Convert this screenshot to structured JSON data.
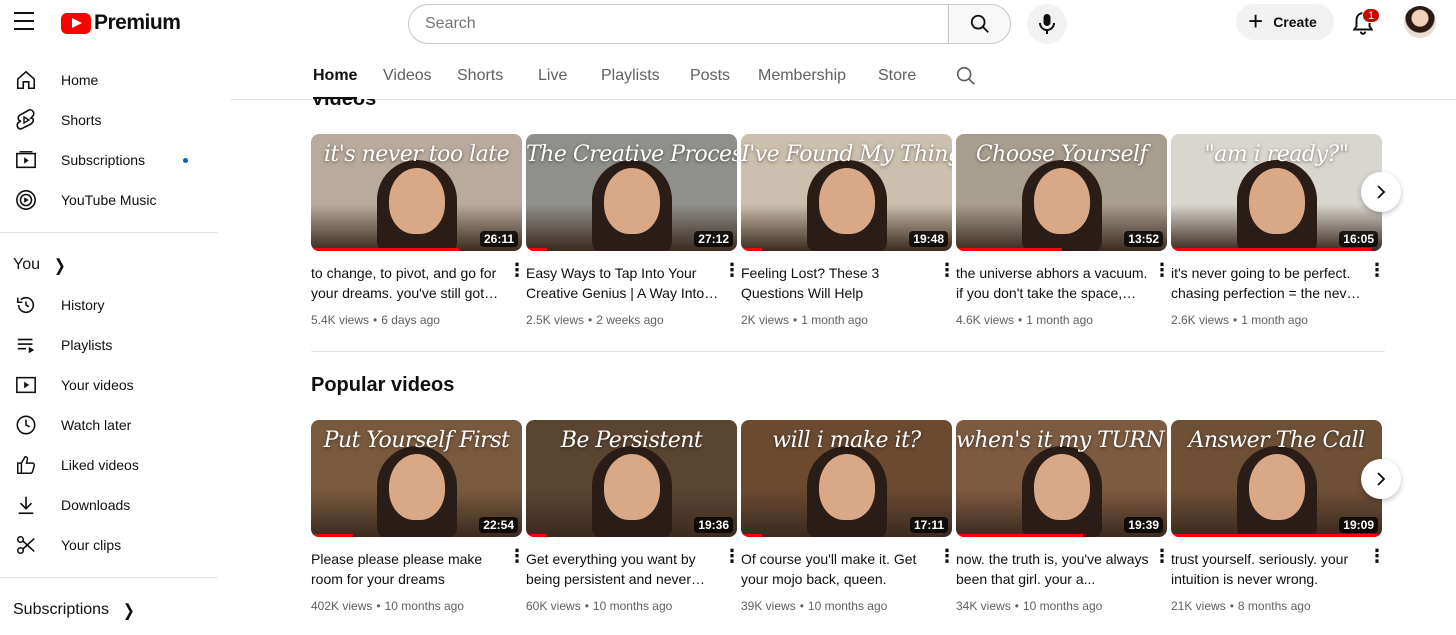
{
  "header": {
    "logo_text": "Premium",
    "search_placeholder": "Search",
    "create_label": "Create",
    "notification_count": "1"
  },
  "sidebar": {
    "main": [
      {
        "label": "Home",
        "icon": "home-icon"
      },
      {
        "label": "Shorts",
        "icon": "shorts-icon"
      },
      {
        "label": "Subscriptions",
        "icon": "subscriptions-icon"
      },
      {
        "label": "YouTube Music",
        "icon": "youtube-music-icon"
      }
    ],
    "you_heading": "You",
    "you": [
      {
        "label": "History",
        "icon": "history-icon"
      },
      {
        "label": "Playlists",
        "icon": "playlists-icon"
      },
      {
        "label": "Your videos",
        "icon": "your-videos-icon"
      },
      {
        "label": "Watch later",
        "icon": "watch-later-icon"
      },
      {
        "label": "Liked videos",
        "icon": "liked-videos-icon"
      },
      {
        "label": "Downloads",
        "icon": "downloads-icon"
      },
      {
        "label": "Your clips",
        "icon": "clips-icon"
      }
    ],
    "subscriptions_heading": "Subscriptions"
  },
  "tabs": [
    "Home",
    "Videos",
    "Shorts",
    "Live",
    "Playlists",
    "Posts",
    "Membership",
    "Store"
  ],
  "sections": [
    {
      "title": "Videos",
      "videos": [
        {
          "thumb_text": "it's never too late",
          "duration": "26:11",
          "title": "to change, to pivot, and go for your dreams. you've still got time.",
          "views": "5.4K views",
          "age": "6 days ago",
          "bg": "#b8aa9c",
          "progress": 0.7
        },
        {
          "thumb_text": "The Creative Process",
          "duration": "27:12",
          "title": "Easy Ways to Tap Into Your Creative Genius | A Way Into the Creative Process",
          "views": "2.5K views",
          "age": "2 weeks ago",
          "bg": "#8f8f8c",
          "progress": 0.1
        },
        {
          "thumb_text": "I've Found My Thing",
          "duration": "19:48",
          "title": "Feeling Lost? These 3 Questions Will Help",
          "views": "2K views",
          "age": "1 month ago",
          "bg": "#cbbfae",
          "progress": 0.1
        },
        {
          "thumb_text": "Choose Yourself",
          "duration": "13:52",
          "title": "the universe abhors a vacuum. if you don't take the space, someone else will.",
          "views": "4.6K views",
          "age": "1 month ago",
          "bg": "#a89e90",
          "progress": 0.5
        },
        {
          "thumb_text": "\"am i ready?\"",
          "duration": "16:05",
          "title": "it's never going to be perfect. chasing perfection = the never-ending task.",
          "views": "2.6K views",
          "age": "1 month ago",
          "bg": "#d9d6cf",
          "progress": 0.95
        }
      ]
    },
    {
      "title": "Popular videos",
      "videos": [
        {
          "thumb_text": "Put Yourself First",
          "duration": "22:54",
          "title": "Please please please make room for your dreams",
          "views": "402K views",
          "age": "10 months ago",
          "bg": "#7a5a3e",
          "progress": 0.2
        },
        {
          "thumb_text": "Be Persistent",
          "duration": "19:36",
          "title": "Get everything you want by being persistent and never giving up.",
          "views": "60K views",
          "age": "10 months ago",
          "bg": "#5b4531",
          "progress": 0.1
        },
        {
          "thumb_text": "will i make it?",
          "duration": "17:11",
          "title": "Of course you'll make it. Get your mojo back, queen.",
          "views": "39K views",
          "age": "10 months ago",
          "bg": "#6b4a30",
          "progress": 0.1
        },
        {
          "thumb_text": "when's it my TURN?",
          "duration": "19:39",
          "title": "now. the truth is, you've always been that girl. your a...",
          "views": "34K views",
          "age": "10 months ago",
          "bg": "#7d5b40",
          "progress": 0.6
        },
        {
          "thumb_text": "Answer The Call",
          "duration": "19:09",
          "title": "trust yourself. seriously. your intuition is never wrong.",
          "views": "21K views",
          "age": "8 months ago",
          "bg": "#6e5036",
          "progress": 1.0
        }
      ]
    }
  ]
}
